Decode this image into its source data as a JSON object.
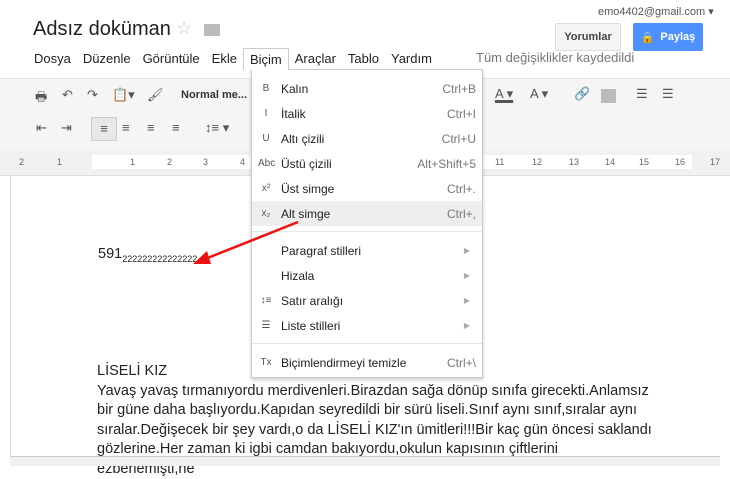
{
  "header": {
    "title": "Adsız doküman",
    "email": "emo4402@gmail.com",
    "comments_label": "Yorumlar",
    "share_label": "Paylaş",
    "saved_status": "Tüm değişiklikler kaydedildi"
  },
  "menubar": [
    "Dosya",
    "Düzenle",
    "Görüntüle",
    "Ekle",
    "Biçim",
    "Araçlar",
    "Tablo",
    "Yardım"
  ],
  "toolbar": {
    "style_select": "Normal me..."
  },
  "ruler": [
    "2",
    "1",
    "1",
    "2",
    "3",
    "4",
    "11",
    "12",
    "13",
    "14",
    "15",
    "16",
    "17"
  ],
  "format_menu": {
    "items": [
      {
        "icon": "bold-icon",
        "glyph": "B",
        "label": "Kalın",
        "shortcut": "Ctrl+B"
      },
      {
        "icon": "italic-icon",
        "glyph": "I",
        "label": "İtalik",
        "shortcut": "Ctrl+I"
      },
      {
        "icon": "underline-icon",
        "glyph": "U",
        "label": "Altı çizili",
        "shortcut": "Ctrl+U"
      },
      {
        "icon": "strikethrough-icon",
        "glyph": "Abc",
        "label": "Üstü çizili",
        "shortcut": "Alt+Shift+5"
      },
      {
        "icon": "superscript-icon",
        "glyph": "x²",
        "label": "Üst simge",
        "shortcut": "Ctrl+."
      },
      {
        "icon": "subscript-icon",
        "glyph": "x₂",
        "label": "Alt simge",
        "shortcut": "Ctrl+,"
      },
      {
        "icon": "",
        "glyph": "",
        "label": "Paragraf stilleri",
        "submenu": true
      },
      {
        "icon": "",
        "glyph": "",
        "label": "Hizala",
        "submenu": true
      },
      {
        "icon": "line-spacing-icon",
        "glyph": "↕≡",
        "label": "Satır aralığı",
        "submenu": true
      },
      {
        "icon": "list-icon",
        "glyph": "☰",
        "label": "Liste stilleri",
        "submenu": true
      },
      {
        "icon": "clear-format-icon",
        "glyph": "Tx",
        "label": "Biçimlendirmeyi temizle",
        "shortcut": "Ctrl+\\"
      }
    ]
  },
  "document": {
    "number": "591",
    "subscript": "222222222222222",
    "heading": "LİSELİ KIZ",
    "paragraph": "Yavaş yavaş tırmanıyordu merdivenleri.Birazdan sağa dönüp sınıfa girecekti.Anlamsız bir güne daha başlıyordu.Kapıdan seyredildi bir sürü liseli.Sınıf aynı sınıf,sıralar aynı sıralar.Değişecek bir şey vardı,o da LİSELİ KIZ'ın ümitleri!!!Bir kaç gün öncesi saklandı gözlerine.Her zaman ki igbi camdan bakıyordu,okulun kapısının çiftlerini ezberlemişti,ne"
  },
  "colors": {
    "share": "#4d90fe",
    "annotation_arrow": "#ee1111"
  }
}
